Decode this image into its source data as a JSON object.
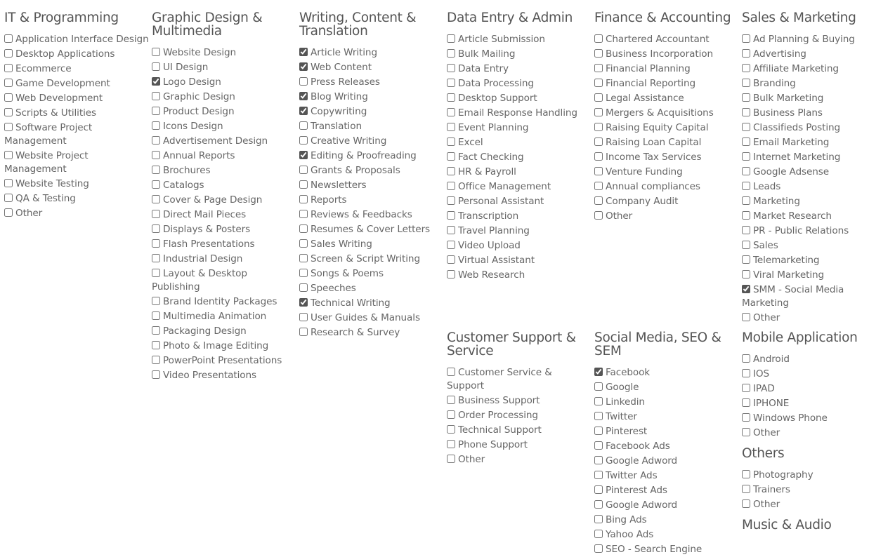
{
  "columns": [
    {
      "sections": [
        {
          "title": "IT & Programming",
          "items": [
            {
              "label": "Application Interface Design",
              "checked": false
            },
            {
              "label": "Desktop Applications",
              "checked": false
            },
            {
              "label": "Ecommerce",
              "checked": false
            },
            {
              "label": "Game Development",
              "checked": false
            },
            {
              "label": "Web Development",
              "checked": false
            },
            {
              "label": "Scripts & Utilities",
              "checked": false
            },
            {
              "label": "Software Project Management",
              "checked": false
            },
            {
              "label": "Website Project Management",
              "checked": false
            },
            {
              "label": "Website Testing",
              "checked": false
            },
            {
              "label": "QA & Testing",
              "checked": false
            },
            {
              "label": "Other",
              "checked": false
            }
          ]
        }
      ]
    },
    {
      "sections": [
        {
          "title": "Graphic Design & Multimedia",
          "items": [
            {
              "label": "Website Design",
              "checked": false
            },
            {
              "label": "UI Design",
              "checked": false
            },
            {
              "label": "Logo Design",
              "checked": true
            },
            {
              "label": "Graphic Design",
              "checked": false
            },
            {
              "label": "Product Design",
              "checked": false
            },
            {
              "label": "Icons Design",
              "checked": false
            },
            {
              "label": "Advertisement Design",
              "checked": false
            },
            {
              "label": "Annual Reports",
              "checked": false
            },
            {
              "label": "Brochures",
              "checked": false
            },
            {
              "label": "Catalogs",
              "checked": false
            },
            {
              "label": "Cover & Page Design",
              "checked": false
            },
            {
              "label": "Direct Mail Pieces",
              "checked": false
            },
            {
              "label": "Displays & Posters",
              "checked": false
            },
            {
              "label": "Flash Presentations",
              "checked": false
            },
            {
              "label": "Industrial Design",
              "checked": false
            },
            {
              "label": "Layout & Desktop Publishing",
              "checked": false
            },
            {
              "label": "Brand Identity Packages",
              "checked": false
            },
            {
              "label": "Multimedia Animation",
              "checked": false
            },
            {
              "label": "Packaging Design",
              "checked": false
            },
            {
              "label": "Photo & Image Editing",
              "checked": false
            },
            {
              "label": "PowerPoint Presentations",
              "checked": false
            },
            {
              "label": "Video Presentations",
              "checked": false
            }
          ]
        }
      ]
    },
    {
      "sections": [
        {
          "title": "Writing, Content & Translation",
          "items": [
            {
              "label": "Article Writing",
              "checked": true
            },
            {
              "label": "Web Content",
              "checked": true
            },
            {
              "label": "Press Releases",
              "checked": false
            },
            {
              "label": "Blog Writing",
              "checked": true
            },
            {
              "label": "Copywriting",
              "checked": true
            },
            {
              "label": "Translation",
              "checked": false
            },
            {
              "label": "Creative Writing",
              "checked": false
            },
            {
              "label": "Editing & Proofreading",
              "checked": true
            },
            {
              "label": "Grants & Proposals",
              "checked": false
            },
            {
              "label": "Newsletters",
              "checked": false
            },
            {
              "label": "Reports",
              "checked": false
            },
            {
              "label": "Reviews & Feedbacks",
              "checked": false
            },
            {
              "label": "Resumes & Cover Letters",
              "checked": false
            },
            {
              "label": "Sales Writing",
              "checked": false
            },
            {
              "label": "Screen & Script Writing",
              "checked": false
            },
            {
              "label": "Songs & Poems",
              "checked": false
            },
            {
              "label": "Speeches",
              "checked": false
            },
            {
              "label": "Technical Writing",
              "checked": true
            },
            {
              "label": "User Guides & Manuals",
              "checked": false
            },
            {
              "label": "Research & Survey",
              "checked": false
            }
          ]
        }
      ]
    },
    {
      "sections": [
        {
          "title": "Data Entry & Admin",
          "items": [
            {
              "label": "Article Submission",
              "checked": false
            },
            {
              "label": "Bulk Mailing",
              "checked": false
            },
            {
              "label": "Data Entry",
              "checked": false
            },
            {
              "label": "Data Processing",
              "checked": false
            },
            {
              "label": "Desktop Support",
              "checked": false
            },
            {
              "label": "Email Response Handling",
              "checked": false
            },
            {
              "label": "Event Planning",
              "checked": false
            },
            {
              "label": "Excel",
              "checked": false
            },
            {
              "label": "Fact Checking",
              "checked": false
            },
            {
              "label": "HR & Payroll",
              "checked": false
            },
            {
              "label": "Office Management",
              "checked": false
            },
            {
              "label": "Personal Assistant",
              "checked": false
            },
            {
              "label": "Transcription",
              "checked": false
            },
            {
              "label": "Travel Planning",
              "checked": false
            },
            {
              "label": "Video Upload",
              "checked": false
            },
            {
              "label": "Virtual Assistant",
              "checked": false
            },
            {
              "label": "Web Research",
              "checked": false
            }
          ]
        },
        {
          "title": "Customer Support & Service",
          "row2": true,
          "items": [
            {
              "label": "Customer Service & Support",
              "checked": false
            },
            {
              "label": "Business Support",
              "checked": false
            },
            {
              "label": "Order Processing",
              "checked": false
            },
            {
              "label": "Technical Support",
              "checked": false
            },
            {
              "label": "Phone Support",
              "checked": false
            },
            {
              "label": "Other",
              "checked": false
            }
          ]
        }
      ]
    },
    {
      "sections": [
        {
          "title": "Finance & Accounting",
          "items": [
            {
              "label": "Chartered Accountant",
              "checked": false
            },
            {
              "label": "Business Incorporation",
              "checked": false
            },
            {
              "label": "Financial Planning",
              "checked": false
            },
            {
              "label": "Financial Reporting",
              "checked": false
            },
            {
              "label": "Legal Assistance",
              "checked": false
            },
            {
              "label": "Mergers & Acquisitions",
              "checked": false
            },
            {
              "label": "Raising Equity Capital",
              "checked": false
            },
            {
              "label": "Raising Loan Capital",
              "checked": false
            },
            {
              "label": "Income Tax Services",
              "checked": false
            },
            {
              "label": "Venture Funding",
              "checked": false
            },
            {
              "label": "Annual compliances",
              "checked": false
            },
            {
              "label": "Company Audit",
              "checked": false
            },
            {
              "label": "Other",
              "checked": false
            }
          ]
        },
        {
          "title": "Social Media, SEO & SEM",
          "row2": true,
          "items": [
            {
              "label": "Facebook",
              "checked": true
            },
            {
              "label": "Google",
              "checked": false
            },
            {
              "label": "Linkedin",
              "checked": false
            },
            {
              "label": "Twitter",
              "checked": false
            },
            {
              "label": "Pinterest",
              "checked": false
            },
            {
              "label": "Facebook Ads",
              "checked": false
            },
            {
              "label": "Google Adword",
              "checked": false
            },
            {
              "label": "Twitter Ads",
              "checked": false
            },
            {
              "label": "Pinterest Ads",
              "checked": false
            },
            {
              "label": "Google Adword",
              "checked": false
            },
            {
              "label": "Bing Ads",
              "checked": false
            },
            {
              "label": "Yahoo Ads",
              "checked": false
            },
            {
              "label": "SEO - Search Engine",
              "checked": false
            }
          ]
        }
      ]
    },
    {
      "sections": [
        {
          "title": "Sales & Marketing",
          "items": [
            {
              "label": "Ad Planning & Buying",
              "checked": false
            },
            {
              "label": "Advertising",
              "checked": false
            },
            {
              "label": "Affiliate Marketing",
              "checked": false
            },
            {
              "label": "Branding",
              "checked": false
            },
            {
              "label": "Bulk Marketing",
              "checked": false
            },
            {
              "label": "Business Plans",
              "checked": false
            },
            {
              "label": "Classifieds Posting",
              "checked": false
            },
            {
              "label": "Email Marketing",
              "checked": false
            },
            {
              "label": "Internet Marketing",
              "checked": false
            },
            {
              "label": "Google Adsense",
              "checked": false
            },
            {
              "label": "Leads",
              "checked": false
            },
            {
              "label": "Marketing",
              "checked": false
            },
            {
              "label": "Market Research",
              "checked": false
            },
            {
              "label": "PR - Public Relations",
              "checked": false
            },
            {
              "label": "Sales",
              "checked": false
            },
            {
              "label": "Telemarketing",
              "checked": false
            },
            {
              "label": "Viral Marketing",
              "checked": false
            },
            {
              "label": "SMM - Social Media Marketing",
              "checked": true
            },
            {
              "label": "Other",
              "checked": false
            }
          ]
        },
        {
          "title": "Mobile Application",
          "row2": true,
          "items": [
            {
              "label": "Android",
              "checked": false
            },
            {
              "label": "IOS",
              "checked": false
            },
            {
              "label": "IPAD",
              "checked": false
            },
            {
              "label": "IPHONE",
              "checked": false
            },
            {
              "label": "Windows Phone",
              "checked": false
            },
            {
              "label": "Other",
              "checked": false
            }
          ]
        },
        {
          "title": "Others",
          "items": [
            {
              "label": "Photography",
              "checked": false
            },
            {
              "label": "Trainers",
              "checked": false
            },
            {
              "label": "Other",
              "checked": false
            }
          ]
        },
        {
          "title": "Music & Audio",
          "items": []
        }
      ]
    }
  ]
}
